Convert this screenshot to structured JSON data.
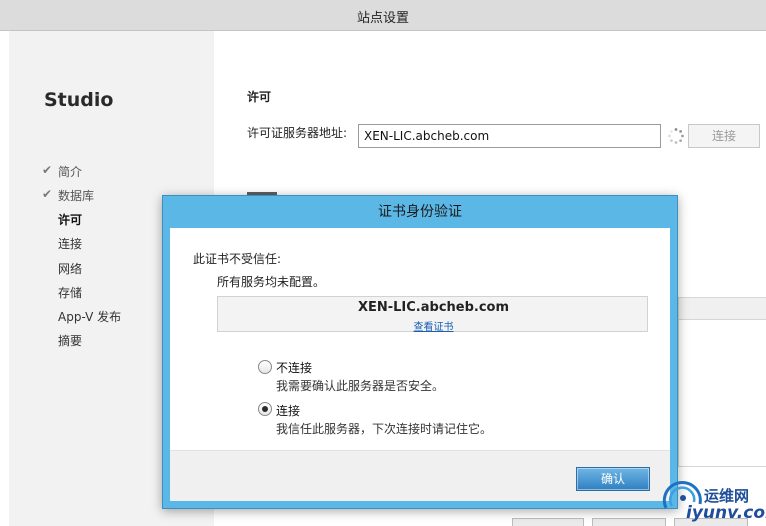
{
  "window": {
    "title": "站点设置"
  },
  "sidebar": {
    "logo": "Studio",
    "items": [
      {
        "label": "简介",
        "done": true
      },
      {
        "label": "数据库",
        "done": true
      },
      {
        "label": "许可",
        "active": true
      },
      {
        "label": "连接"
      },
      {
        "label": "网络"
      },
      {
        "label": "存储"
      },
      {
        "label": "App-V 发布"
      },
      {
        "label": "摘要"
      }
    ]
  },
  "main": {
    "title": "许可",
    "license_label": "许可证服务器地址:",
    "license_value": "XEN-LIC.abcheb.com",
    "connect_label": "连接"
  },
  "dialog": {
    "title": "证书身份验证",
    "warning": "此证书不受信任:",
    "sub": "所有服务均未配置。",
    "cert_host": "XEN-LIC.abcheb.com",
    "view_cert": "查看证书",
    "option_no_label": "不连接",
    "option_no_desc": "我需要确认此服务器是否安全。",
    "option_yes_label": "连接",
    "option_yes_desc": "我信任此服务器，下次连接时请记住它。",
    "selected": "连接",
    "ok_label": "确认"
  },
  "watermark": {
    "line1": "运维网",
    "line2": "iyunv.com"
  },
  "colors": {
    "dialog_accent": "#5bb8e6",
    "ok_button": "#2f7fc0",
    "watermark": "#1f4e9a"
  }
}
